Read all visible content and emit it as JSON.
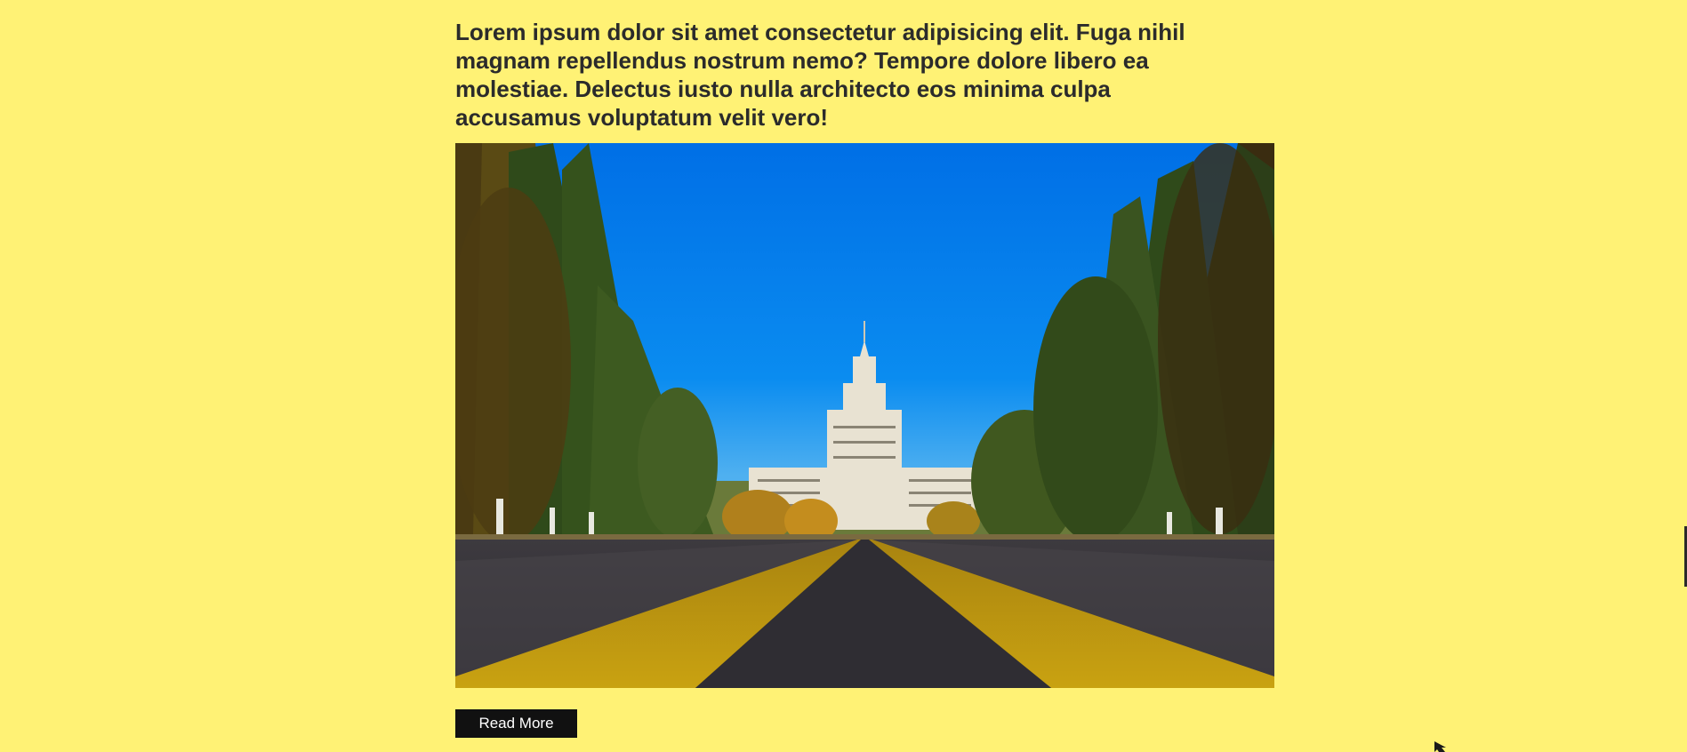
{
  "article": {
    "headline": "Lorem ipsum dolor sit amet consectetur adipisicing elit. Fuga nihil magnam repellendus nostrum nemo? Tempore dolore libero ea molestiae. Delectus iusto nulla architecto eos minima culpa accusamus voluptatum velit vero!",
    "read_more_label": "Read More"
  },
  "colors": {
    "page_background": "#fff275",
    "headline_text": "#2b2b2b",
    "button_background": "#111111",
    "button_text": "#ffffff"
  },
  "icons": {
    "cursor": "mouse-pointer-icon"
  }
}
